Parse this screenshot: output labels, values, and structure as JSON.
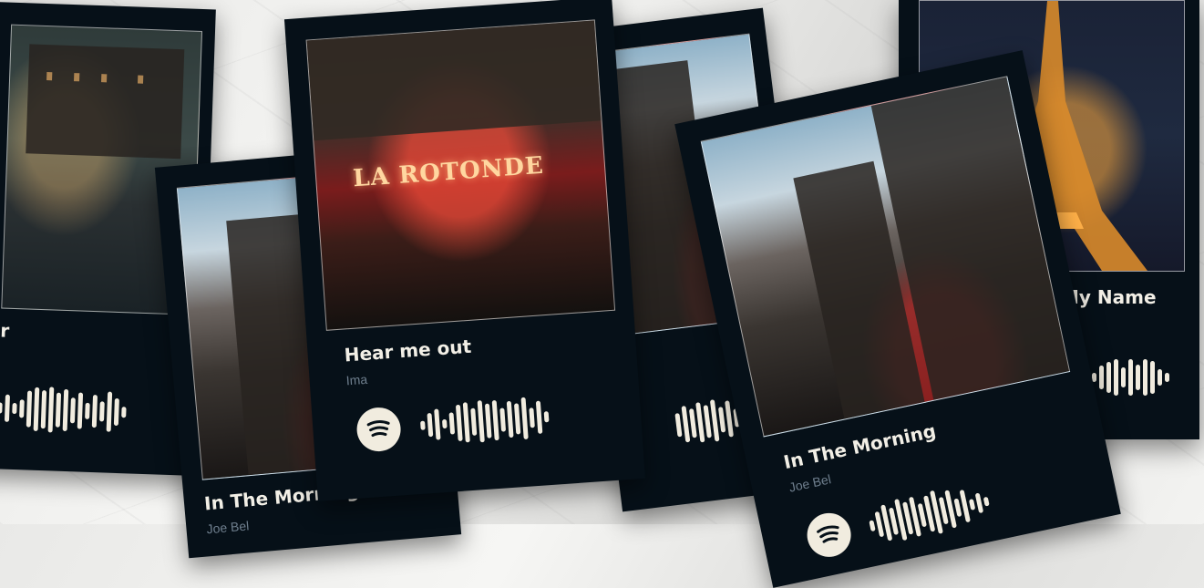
{
  "cards": {
    "c1": {
      "title": "r",
      "artist": ""
    },
    "c2": {
      "title": "In The Morning",
      "artist": "Joe Bel"
    },
    "c3": {
      "title": "Hear me out",
      "artist": "Ima"
    },
    "c4": {
      "title": "",
      "artist": ""
    },
    "c5": {
      "title": "In The Morning",
      "artist": "Joe Bel"
    },
    "c6": {
      "title": "My Name",
      "artist": ""
    }
  },
  "sign": {
    "text": "LA ROTONDE"
  },
  "icons": {
    "spotify": "spotify-icon"
  },
  "colors": {
    "card": "#061018",
    "accent": "#f1ecdf",
    "artist": "#6f7f8e"
  }
}
